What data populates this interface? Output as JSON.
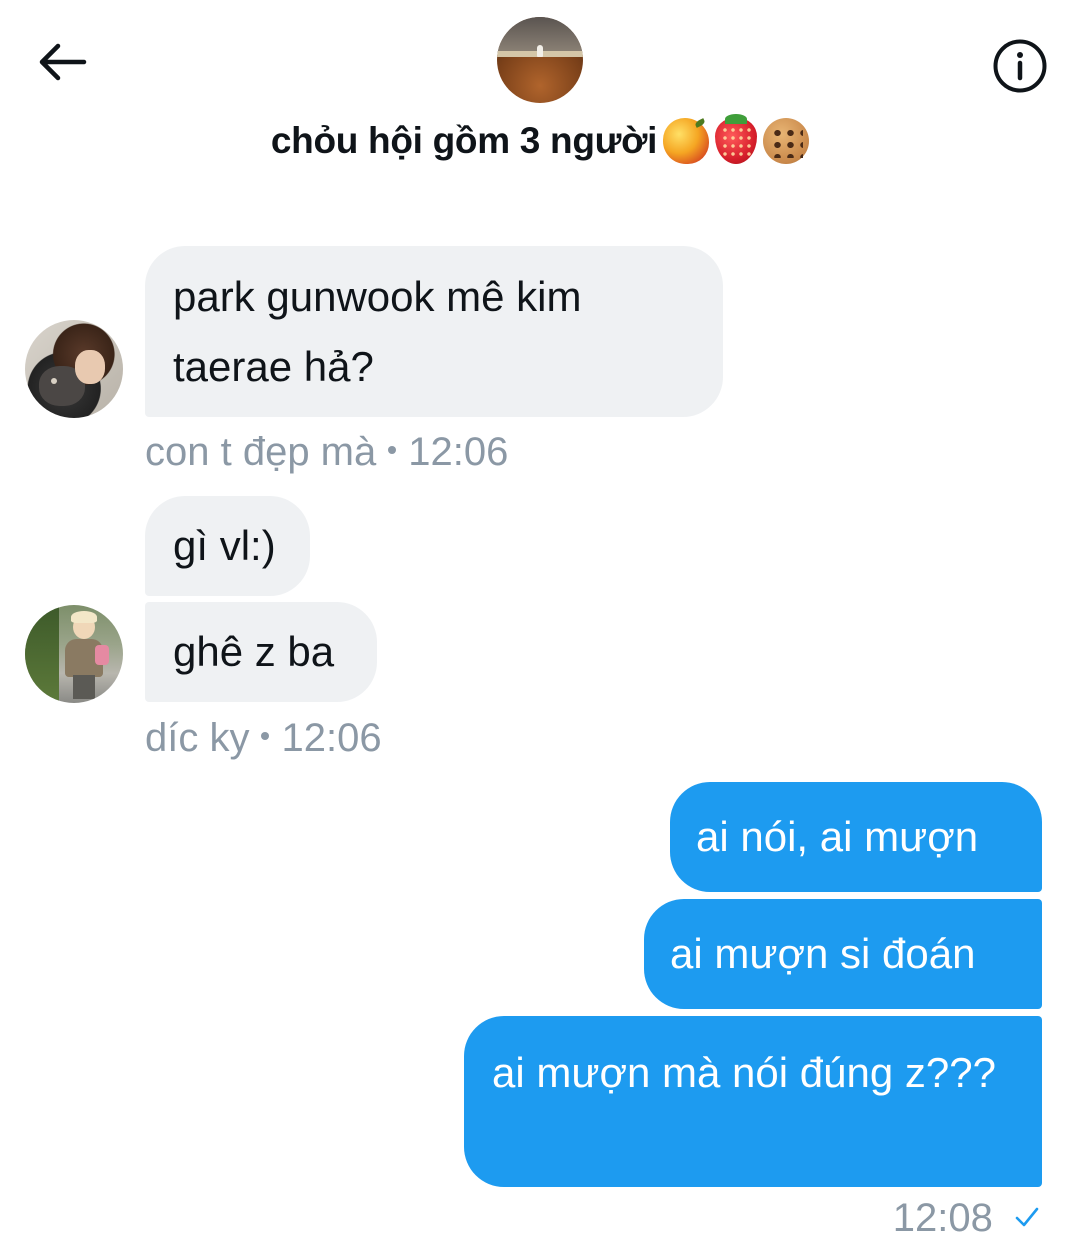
{
  "header": {
    "back_icon": "arrow-left-icon",
    "info_icon": "info-icon",
    "group_name": "chỏu hội gồm 3 người",
    "group_emojis": [
      "mango-emoji",
      "strawberry-emoji",
      "cookie-emoji"
    ]
  },
  "messages": [
    {
      "direction": "in",
      "text": "park gunwook mê kim taerae hả?"
    },
    {
      "direction": "in",
      "text": "gì vl:)"
    },
    {
      "direction": "in",
      "text": "ghê z ba"
    },
    {
      "direction": "out",
      "text": "ai nói, ai mượn"
    },
    {
      "direction": "out",
      "text": "ai mượn si đoán"
    },
    {
      "direction": "out",
      "text": "ai mượn mà nói đúng z???"
    }
  ],
  "meta": {
    "group1_sender": "con t đẹp mà",
    "group1_time": "12:06",
    "group2_sender": "díc ky",
    "group2_time": "12:06",
    "outgoing_time": "12:08",
    "outgoing_status_icon": "sent-check-icon"
  },
  "colors": {
    "incoming_bubble": "#eff1f3",
    "outgoing_bubble": "#1d9bf0",
    "meta_text": "#8b98a5",
    "check_mark": "#1d9bf0"
  }
}
